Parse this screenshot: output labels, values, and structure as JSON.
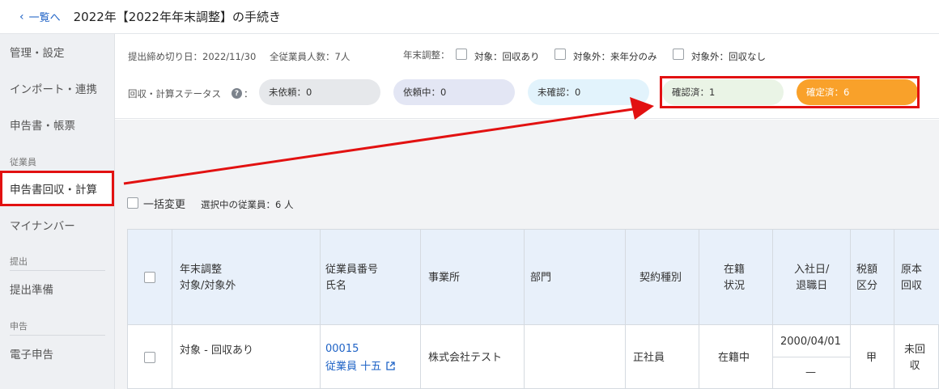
{
  "header": {
    "back_label": "一覧へ",
    "title": "2022年【2022年年末調整】の手続き"
  },
  "sidebar": {
    "items": [
      {
        "label": "管理・設定"
      },
      {
        "label": "インポート・連携"
      },
      {
        "label": "申告書・帳票"
      },
      {
        "label": "申告書回収・計算"
      },
      {
        "label": "マイナンバー"
      },
      {
        "label": "提出準備"
      },
      {
        "label": "電子申告"
      }
    ],
    "sections": {
      "employee": "従業員",
      "submit": "提出",
      "declare": "申告"
    }
  },
  "filters": {
    "deadline": "提出締め切り日：2022/11/30",
    "employee_count": "全従業員人数：7人",
    "adjustment_label": "年末調整：",
    "options": [
      {
        "label": "対象：回収あり"
      },
      {
        "label": "対象外：来年分のみ"
      },
      {
        "label": "対象外：回収なし"
      }
    ],
    "status_label": "回収・計算ステータス",
    "status_colon": "：",
    "help_icon": "?",
    "statuses": [
      {
        "label": "未依頼：0",
        "color": "#e6e8eb"
      },
      {
        "label": "依頼中：0",
        "color": "#e3e6f4"
      },
      {
        "label": "未確認：0",
        "color": "#e2f3fc"
      },
      {
        "label": "確認済：1",
        "color": "#eaf4e6"
      },
      {
        "label": "確定済：6",
        "color": "#f9a12a"
      }
    ]
  },
  "bulk": {
    "label": "一括変更",
    "selected": "選択中の従業員：6 人"
  },
  "table": {
    "headers": {
      "adjust_1": "年末調整",
      "adjust_2": "対象/対象外",
      "emp_1": "従業員番号",
      "emp_2": "氏名",
      "office": "事業所",
      "dept": "部門",
      "contract": "契約種別",
      "status_1": "在籍",
      "status_2": "状況",
      "date_1": "入社日/",
      "date_2": "退職日",
      "tax_1": "税額",
      "tax_2": "区分",
      "orig_1": "原本",
      "orig_2": "回収"
    },
    "rows": [
      {
        "adjust": "対象 - 回収あり",
        "emp_no": "00015",
        "emp_name": "従業員 十五",
        "office": "株式会社テスト",
        "dept": "",
        "contract": "正社員",
        "status": "在籍中",
        "join_date": "2000/04/01",
        "leave_date": "—",
        "tax": "甲",
        "orig_1": "未回",
        "orig_2": "収"
      }
    ]
  },
  "colors": {
    "accent": "#1f63c6",
    "highlight": "#e21111",
    "confirmed": "#f9a12a"
  }
}
